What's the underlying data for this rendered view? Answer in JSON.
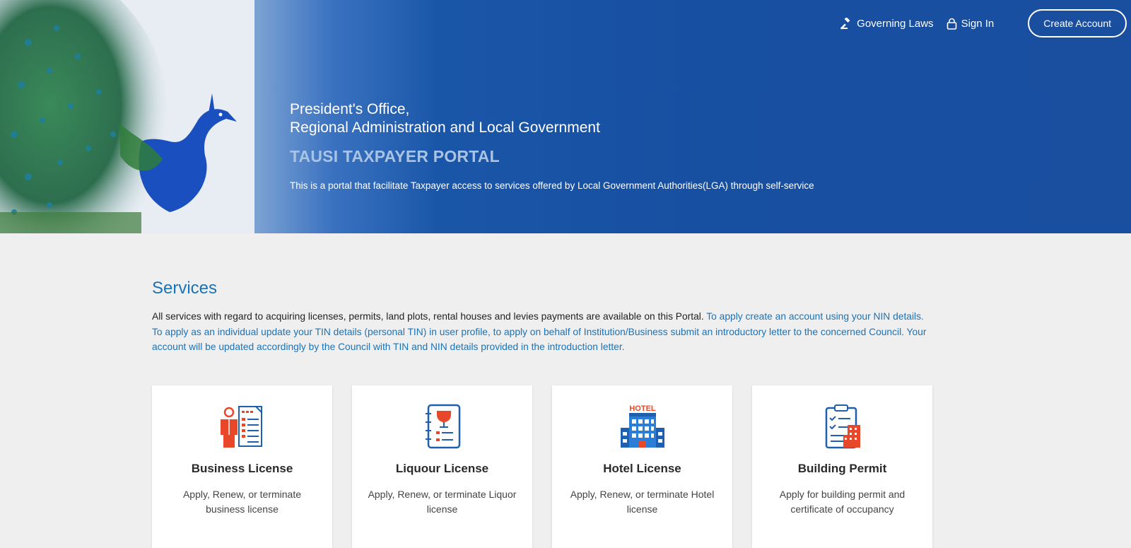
{
  "header": {
    "governing_laws_label": "Governing Laws",
    "sign_in_label": "Sign In",
    "create_account_label": "Create Account"
  },
  "hero": {
    "org_line1": "President's Office,",
    "org_line2": "Regional Administration and Local Government",
    "portal_title": "TAUSI TAXPAYER PORTAL",
    "description": "This is a portal that facilitate Taxpayer access to services offered by Local Government Authorities(LGA) through self-service"
  },
  "services": {
    "title": "Services",
    "intro_text": "All services with regard to acquiring licenses, permits, land plots, rental houses and levies payments are available on this Portal. ",
    "highlight_text": "To apply create an account using your NIN details. To apply as an individual update your TIN details (personal TIN) in user profile, to apply on behalf of Institution/Business submit an introductory letter to the concerned Council. Your account will be updated accordingly by the Council with TIN and NIN details provided in the introduction letter.",
    "cards": [
      {
        "icon": "business-license-icon",
        "title": "Business License",
        "description": "Apply, Renew, or terminate business license"
      },
      {
        "icon": "liquour-license-icon",
        "title": "Liquour License",
        "description": "Apply, Renew, or terminate Liquor license"
      },
      {
        "icon": "hotel-icon",
        "title": "Hotel License",
        "description": "Apply, Renew, or terminate Hotel license",
        "icon_text": "HOTEL"
      },
      {
        "icon": "building-permit-icon",
        "title": "Building Permit",
        "description": "Apply for building permit and certificate of occupancy"
      }
    ]
  },
  "colors": {
    "hero_blue": "#174fa1",
    "accent_blue": "#1a73b8",
    "icon_orange": "#e8472a",
    "icon_blue": "#1f5fb0"
  }
}
